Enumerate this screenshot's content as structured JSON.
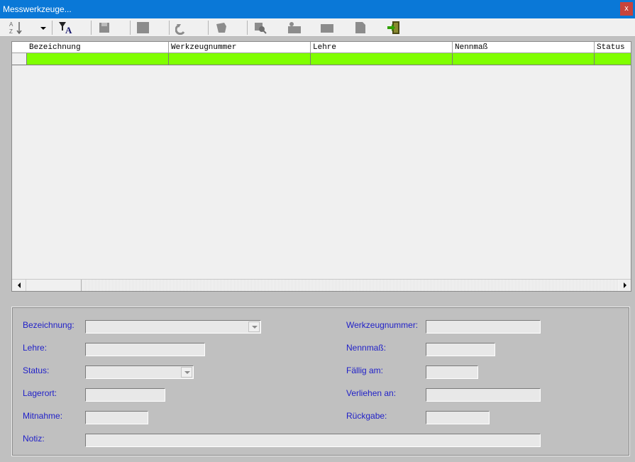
{
  "window": {
    "title": "Messwerkzeuge...",
    "close_label": "x"
  },
  "toolbar": {
    "icons": [
      "sort-az-icon",
      "dropdown-arrow-icon",
      "filter-icon",
      "save-icon",
      "delete-icon",
      "undo-icon",
      "eraser-icon",
      "search-icon",
      "lend-icon",
      "card-icon",
      "document-icon",
      "exit-icon"
    ]
  },
  "grid": {
    "columns": [
      "Bezeichnung",
      "Werkzeugnummer",
      "Lehre",
      "Nennmaß",
      "Status"
    ],
    "selected_row_color": "#80ff00"
  },
  "form": {
    "bezeichnung_label": "Bezeichnung:",
    "lehre_label": "Lehre:",
    "status_label": "Status:",
    "lagerort_label": "Lagerort:",
    "mitnahme_label": "Mitnahme:",
    "notiz_label": "Notiz:",
    "werkzeugnummer_label": "Werkzeugnummer:",
    "nennmass_label": "Nennmaß:",
    "faellig_label": "Fällig am:",
    "verliehen_label": "Verliehen an:",
    "rueckgabe_label": "Rückgabe:",
    "label_color": "#1f1fc8"
  }
}
